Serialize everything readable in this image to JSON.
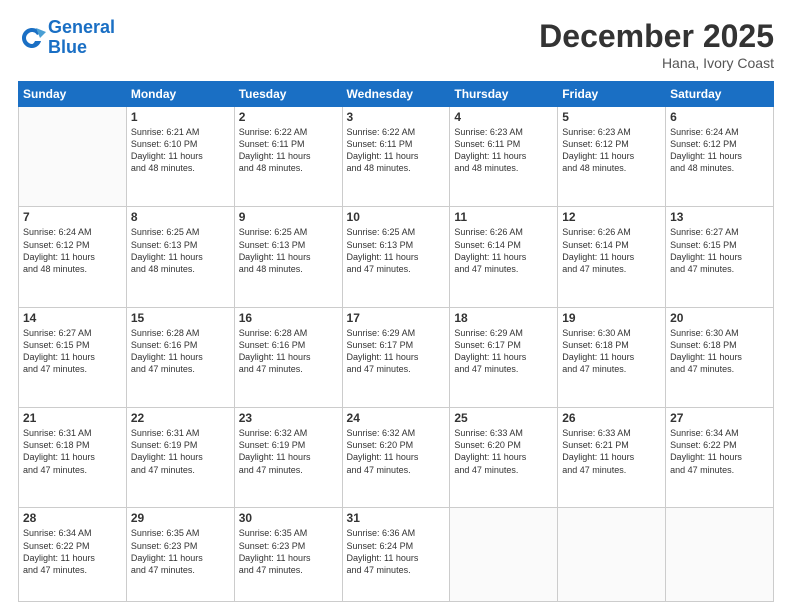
{
  "header": {
    "logo_line1": "General",
    "logo_line2": "Blue",
    "month": "December 2025",
    "location": "Hana, Ivory Coast"
  },
  "days_of_week": [
    "Sunday",
    "Monday",
    "Tuesday",
    "Wednesday",
    "Thursday",
    "Friday",
    "Saturday"
  ],
  "weeks": [
    [
      {
        "day": "",
        "info": ""
      },
      {
        "day": "1",
        "info": "Sunrise: 6:21 AM\nSunset: 6:10 PM\nDaylight: 11 hours\nand 48 minutes."
      },
      {
        "day": "2",
        "info": "Sunrise: 6:22 AM\nSunset: 6:11 PM\nDaylight: 11 hours\nand 48 minutes."
      },
      {
        "day": "3",
        "info": "Sunrise: 6:22 AM\nSunset: 6:11 PM\nDaylight: 11 hours\nand 48 minutes."
      },
      {
        "day": "4",
        "info": "Sunrise: 6:23 AM\nSunset: 6:11 PM\nDaylight: 11 hours\nand 48 minutes."
      },
      {
        "day": "5",
        "info": "Sunrise: 6:23 AM\nSunset: 6:12 PM\nDaylight: 11 hours\nand 48 minutes."
      },
      {
        "day": "6",
        "info": "Sunrise: 6:24 AM\nSunset: 6:12 PM\nDaylight: 11 hours\nand 48 minutes."
      }
    ],
    [
      {
        "day": "7",
        "info": "Sunrise: 6:24 AM\nSunset: 6:12 PM\nDaylight: 11 hours\nand 48 minutes."
      },
      {
        "day": "8",
        "info": "Sunrise: 6:25 AM\nSunset: 6:13 PM\nDaylight: 11 hours\nand 48 minutes."
      },
      {
        "day": "9",
        "info": "Sunrise: 6:25 AM\nSunset: 6:13 PM\nDaylight: 11 hours\nand 48 minutes."
      },
      {
        "day": "10",
        "info": "Sunrise: 6:25 AM\nSunset: 6:13 PM\nDaylight: 11 hours\nand 47 minutes."
      },
      {
        "day": "11",
        "info": "Sunrise: 6:26 AM\nSunset: 6:14 PM\nDaylight: 11 hours\nand 47 minutes."
      },
      {
        "day": "12",
        "info": "Sunrise: 6:26 AM\nSunset: 6:14 PM\nDaylight: 11 hours\nand 47 minutes."
      },
      {
        "day": "13",
        "info": "Sunrise: 6:27 AM\nSunset: 6:15 PM\nDaylight: 11 hours\nand 47 minutes."
      }
    ],
    [
      {
        "day": "14",
        "info": "Sunrise: 6:27 AM\nSunset: 6:15 PM\nDaylight: 11 hours\nand 47 minutes."
      },
      {
        "day": "15",
        "info": "Sunrise: 6:28 AM\nSunset: 6:16 PM\nDaylight: 11 hours\nand 47 minutes."
      },
      {
        "day": "16",
        "info": "Sunrise: 6:28 AM\nSunset: 6:16 PM\nDaylight: 11 hours\nand 47 minutes."
      },
      {
        "day": "17",
        "info": "Sunrise: 6:29 AM\nSunset: 6:17 PM\nDaylight: 11 hours\nand 47 minutes."
      },
      {
        "day": "18",
        "info": "Sunrise: 6:29 AM\nSunset: 6:17 PM\nDaylight: 11 hours\nand 47 minutes."
      },
      {
        "day": "19",
        "info": "Sunrise: 6:30 AM\nSunset: 6:18 PM\nDaylight: 11 hours\nand 47 minutes."
      },
      {
        "day": "20",
        "info": "Sunrise: 6:30 AM\nSunset: 6:18 PM\nDaylight: 11 hours\nand 47 minutes."
      }
    ],
    [
      {
        "day": "21",
        "info": "Sunrise: 6:31 AM\nSunset: 6:18 PM\nDaylight: 11 hours\nand 47 minutes."
      },
      {
        "day": "22",
        "info": "Sunrise: 6:31 AM\nSunset: 6:19 PM\nDaylight: 11 hours\nand 47 minutes."
      },
      {
        "day": "23",
        "info": "Sunrise: 6:32 AM\nSunset: 6:19 PM\nDaylight: 11 hours\nand 47 minutes."
      },
      {
        "day": "24",
        "info": "Sunrise: 6:32 AM\nSunset: 6:20 PM\nDaylight: 11 hours\nand 47 minutes."
      },
      {
        "day": "25",
        "info": "Sunrise: 6:33 AM\nSunset: 6:20 PM\nDaylight: 11 hours\nand 47 minutes."
      },
      {
        "day": "26",
        "info": "Sunrise: 6:33 AM\nSunset: 6:21 PM\nDaylight: 11 hours\nand 47 minutes."
      },
      {
        "day": "27",
        "info": "Sunrise: 6:34 AM\nSunset: 6:22 PM\nDaylight: 11 hours\nand 47 minutes."
      }
    ],
    [
      {
        "day": "28",
        "info": "Sunrise: 6:34 AM\nSunset: 6:22 PM\nDaylight: 11 hours\nand 47 minutes."
      },
      {
        "day": "29",
        "info": "Sunrise: 6:35 AM\nSunset: 6:23 PM\nDaylight: 11 hours\nand 47 minutes."
      },
      {
        "day": "30",
        "info": "Sunrise: 6:35 AM\nSunset: 6:23 PM\nDaylight: 11 hours\nand 47 minutes."
      },
      {
        "day": "31",
        "info": "Sunrise: 6:36 AM\nSunset: 6:24 PM\nDaylight: 11 hours\nand 47 minutes."
      },
      {
        "day": "",
        "info": ""
      },
      {
        "day": "",
        "info": ""
      },
      {
        "day": "",
        "info": ""
      }
    ]
  ]
}
